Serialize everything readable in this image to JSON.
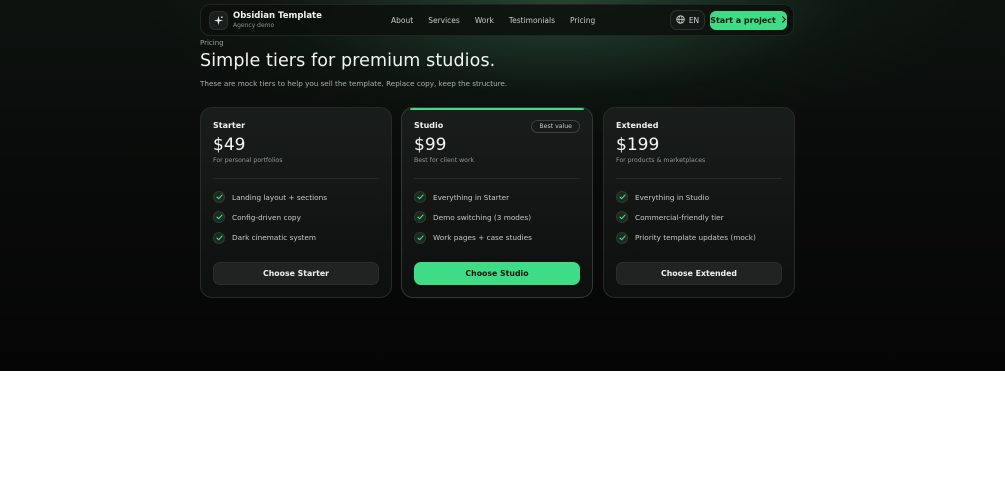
{
  "nav": {
    "brand_title": "Obsidian Template",
    "brand_subtitle": "Agency demo",
    "logo_icon": "sparkle-icon",
    "links": [
      "About",
      "Services",
      "Work",
      "Testimonials",
      "Pricing"
    ],
    "language": "EN",
    "cta_label": "Start a project",
    "accent": "#3fdc87"
  },
  "header": {
    "eyebrow": "Pricing",
    "headline": "Simple tiers for premium studios.",
    "lede": "These are mock tiers to help you sell the template. Replace copy, keep the structure."
  },
  "plans": [
    {
      "name": "Starter",
      "price": "$49",
      "subtitle": "For personal portfolios",
      "features": [
        "Landing layout + sections",
        "Config-driven copy",
        "Dark cinematic system"
      ],
      "button": "Choose Starter"
    },
    {
      "name": "Studio",
      "price": "$99",
      "subtitle": "Best for client work",
      "badge": "Best value",
      "features": [
        "Everything in Starter",
        "Demo switching (3 modes)",
        "Work pages + case studies"
      ],
      "button": "Choose Studio"
    },
    {
      "name": "Extended",
      "price": "$199",
      "subtitle": "For products & marketplaces",
      "features": [
        "Everything in Studio",
        "Commercial-friendly tier",
        "Priority template updates (mock)"
      ],
      "button": "Choose Extended"
    }
  ]
}
